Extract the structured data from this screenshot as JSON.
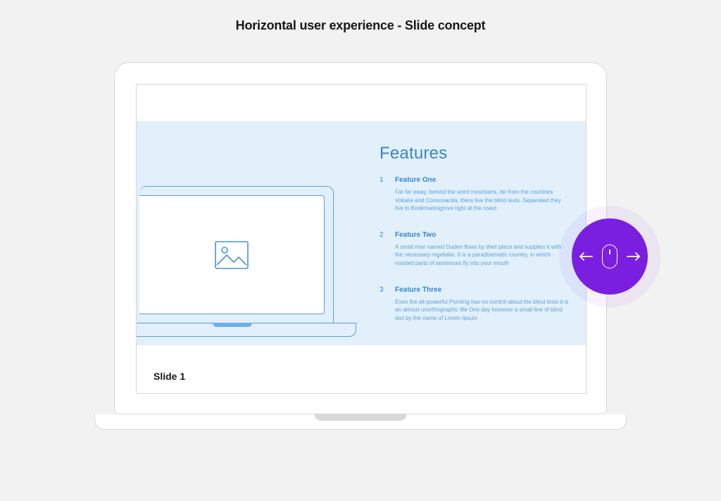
{
  "page": {
    "title": "Horizontal user experience -  Slide concept"
  },
  "slide": {
    "label": "Slide 1",
    "heading": "Features",
    "features": [
      {
        "num": "1",
        "title": "Feature One",
        "desc": "Far far away, behind the word mountains, far from the countries Vokalia and Consonantia, there live the blind texts. Separated they live in Bookmarksgrove right at the coast."
      },
      {
        "num": "2",
        "title": "Feature Two",
        "desc": "A small river named Duden flows by their place and supplies it with the necessary regelialia. It is a paradisematic country, in which roasted parts of sentences fly into your mouth"
      },
      {
        "num": "3",
        "title": "Feature Three",
        "desc": "Even the all-powerful Pointing has no control about the blind texts it is an almost unorthographic life One day however a small line of blind text by the name of Lorem Ipsum"
      }
    ]
  },
  "icons": {
    "image_placeholder": "image-placeholder-icon",
    "arrow_left": "arrow-left-icon",
    "arrow_right": "arrow-right-icon",
    "mouse": "mouse-scroll-icon"
  },
  "colors": {
    "accent_blue": "#3b86c8",
    "slide_bg": "#e1f0fb",
    "badge_purple": "#7a1fe0"
  }
}
